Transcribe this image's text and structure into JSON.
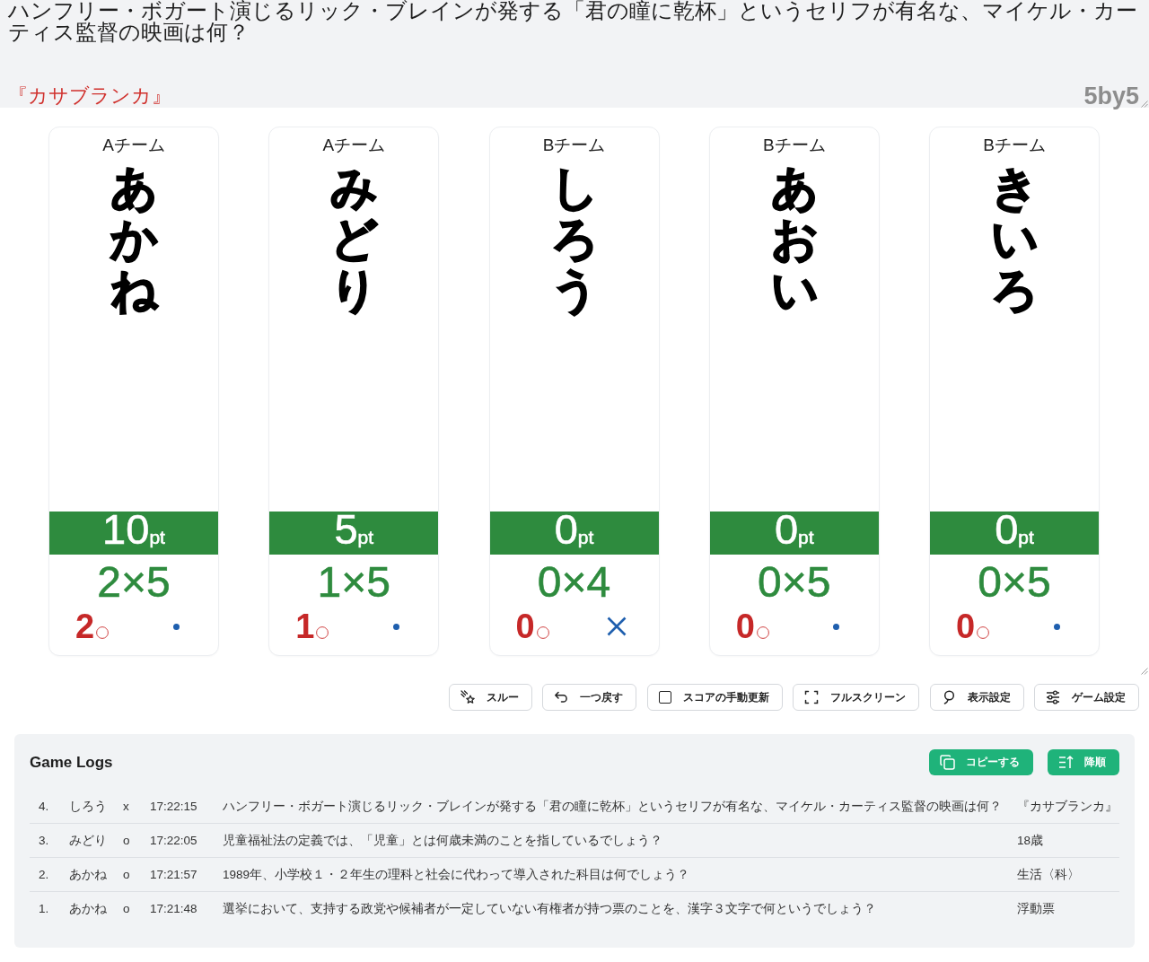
{
  "question": {
    "text": "ハンフリー・ボガート演じるリック・ブレインが発する「君の瞳に乾杯」というセリフが有名な、マイケル・カーティス監督の映画は何？",
    "answer": "『カサブランカ』"
  },
  "brand": "5by5",
  "cards": [
    {
      "team": "Aチーム",
      "name": "あかね",
      "points": "10",
      "unit": "pt",
      "multiplier": "2×5",
      "correct": "2",
      "missed": false
    },
    {
      "team": "Aチーム",
      "name": "みどり",
      "points": "5",
      "unit": "pt",
      "multiplier": "1×5",
      "correct": "1",
      "missed": false
    },
    {
      "team": "Bチーム",
      "name": "しろう",
      "points": "0",
      "unit": "pt",
      "multiplier": "0×4",
      "correct": "0",
      "missed": true
    },
    {
      "team": "Bチーム",
      "name": "あおい",
      "points": "0",
      "unit": "pt",
      "multiplier": "0×5",
      "correct": "0",
      "missed": false
    },
    {
      "team": "Bチーム",
      "name": "きいろ",
      "points": "0",
      "unit": "pt",
      "multiplier": "0×5",
      "correct": "0",
      "missed": false
    }
  ],
  "toolbar": [
    {
      "kind": "button",
      "label": "スルー"
    },
    {
      "kind": "button",
      "label": "一つ戻す"
    },
    {
      "kind": "toggle",
      "label": "スコアの手動更新",
      "checked": false
    },
    {
      "kind": "button",
      "label": "フルスクリーン"
    },
    {
      "kind": "button",
      "label": "表示設定"
    },
    {
      "kind": "button",
      "label": "ゲーム設定"
    }
  ],
  "game_logs": {
    "title": "Game Logs",
    "actions": [
      {
        "label": "コピーする"
      },
      {
        "label": "降順"
      }
    ],
    "rows": [
      {
        "number": "4.",
        "player": "しろう",
        "result": "x",
        "time": "17:22:15",
        "question": "ハンフリー・ボガート演じるリック・ブレインが発する「君の瞳に乾杯」というセリフが有名な、マイケル・カーティス監督の映画は何？",
        "answer": "『カサブランカ』"
      },
      {
        "number": "3.",
        "player": "みどり",
        "result": "o",
        "time": "17:22:05",
        "question": "児童福祉法の定義では、「児童」とは何歳未満のことを指しているでしょう？",
        "answer": "18歳"
      },
      {
        "number": "2.",
        "player": "あかね",
        "result": "o",
        "time": "17:21:57",
        "question": "1989年、小学校１・２年生の理科と社会に代わって導入された科目は何でしょう？",
        "answer": "生活〈科〉"
      },
      {
        "number": "1.",
        "player": "あかね",
        "result": "o",
        "time": "17:21:48",
        "question": "選挙において、支持する政党や候補者が一定していない有権者が持つ票のことを、漢字３文字で何というでしょう？",
        "answer": "浮動票"
      }
    ]
  }
}
